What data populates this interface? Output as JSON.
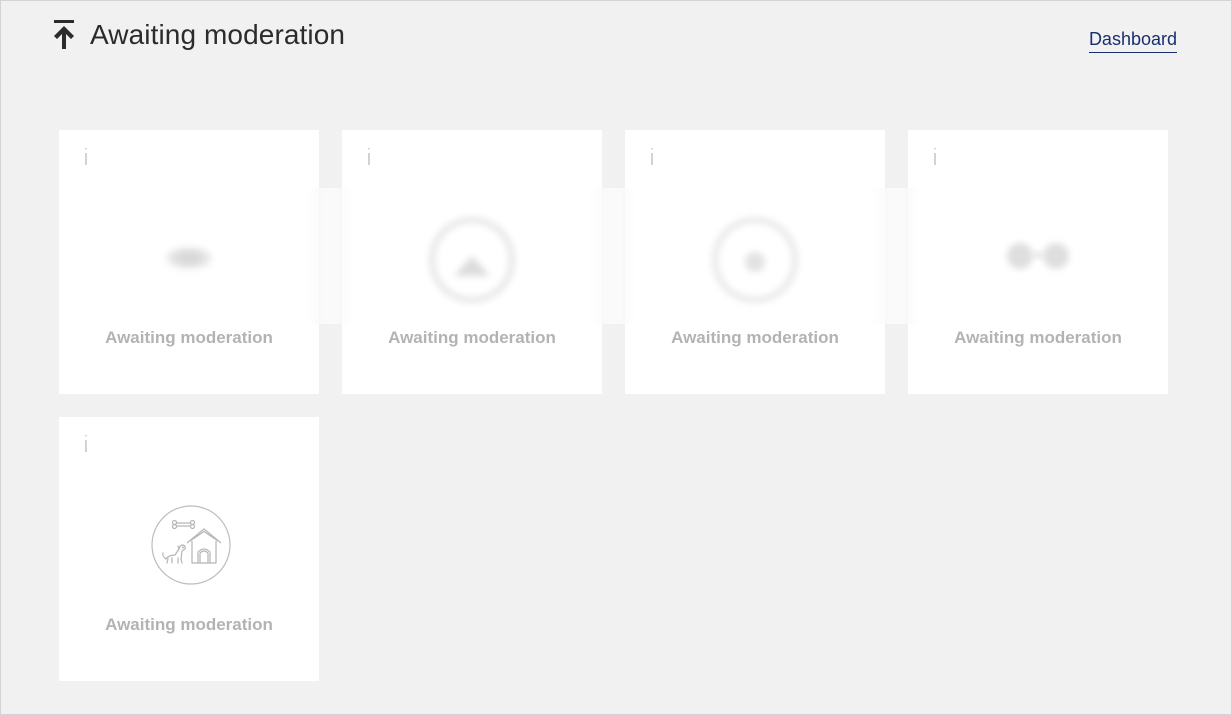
{
  "header": {
    "title": "Awaiting moderation",
    "title_icon": "upload-arrow-icon",
    "dashboard_link": "Dashboard"
  },
  "colors": {
    "background": "#f1f1f1",
    "card": "#ffffff",
    "link": "#1a2e6e",
    "muted_text": "#b3b3b3",
    "title_text": "#2b2b2b"
  },
  "cards": [
    {
      "info": "i",
      "status": "Awaiting moderation",
      "thumbnail": "blurred-oval-icon"
    },
    {
      "info": "i",
      "status": "Awaiting moderation",
      "thumbnail": "blurred-circle-mountain-icon"
    },
    {
      "info": "i",
      "status": "Awaiting moderation",
      "thumbnail": "blurred-circle-icon"
    },
    {
      "info": "i",
      "status": "Awaiting moderation",
      "thumbnail": "blurred-glasses-icon"
    },
    {
      "info": "i",
      "status": "Awaiting moderation",
      "thumbnail": "dog-and-doghouse-icon"
    }
  ]
}
